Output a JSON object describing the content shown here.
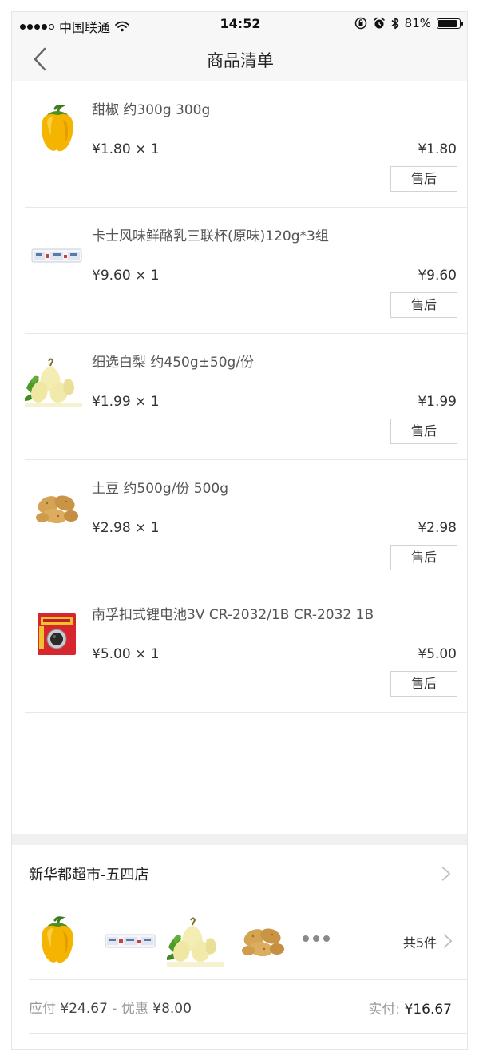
{
  "status_bar": {
    "carrier": "中国联通",
    "time": "14:52",
    "battery_text": "81%",
    "battery_level": 0.81
  },
  "nav": {
    "title": "商品清单",
    "back_icon": "chevron-left-icon"
  },
  "items": [
    {
      "name": "甜椒 约300g 300g",
      "unit_price": "¥1.80 × 1",
      "total": "¥1.80",
      "after_sale": "售后",
      "image": "yellow-pepper"
    },
    {
      "name": "卡士风味鲜酪乳三联杯(原味)120g*3组",
      "unit_price": "¥9.60 × 1",
      "total": "¥9.60",
      "after_sale": "售后",
      "image": "yogurt-pack"
    },
    {
      "name": "细选白梨 约450g±50g/份",
      "unit_price": "¥1.99 × 1",
      "total": "¥1.99",
      "after_sale": "售后",
      "image": "pears"
    },
    {
      "name": "土豆 约500g/份 500g",
      "unit_price": "¥2.98 × 1",
      "total": "¥2.98",
      "after_sale": "售后",
      "image": "potatoes"
    },
    {
      "name": "南孚扣式锂电池3V CR-2032/1B CR-2032 1B",
      "unit_price": "¥5.00 × 1",
      "total": "¥5.00",
      "after_sale": "售后",
      "image": "coin-battery"
    }
  ],
  "store": {
    "name": "新华都超市-五四店"
  },
  "order_summary": {
    "count_text": "共5件",
    "payable_label": "应付",
    "payable_amount": "¥24.67",
    "separator": "-",
    "discount_label": "优惠",
    "discount_amount": "¥8.00",
    "paid_label": "实付:",
    "paid_amount": "¥16.67"
  },
  "colors": {
    "bar_bg": "#f7f7f7",
    "divider": "#e8e8e8",
    "band": "#f0f0f0",
    "text_muted": "#999999"
  }
}
